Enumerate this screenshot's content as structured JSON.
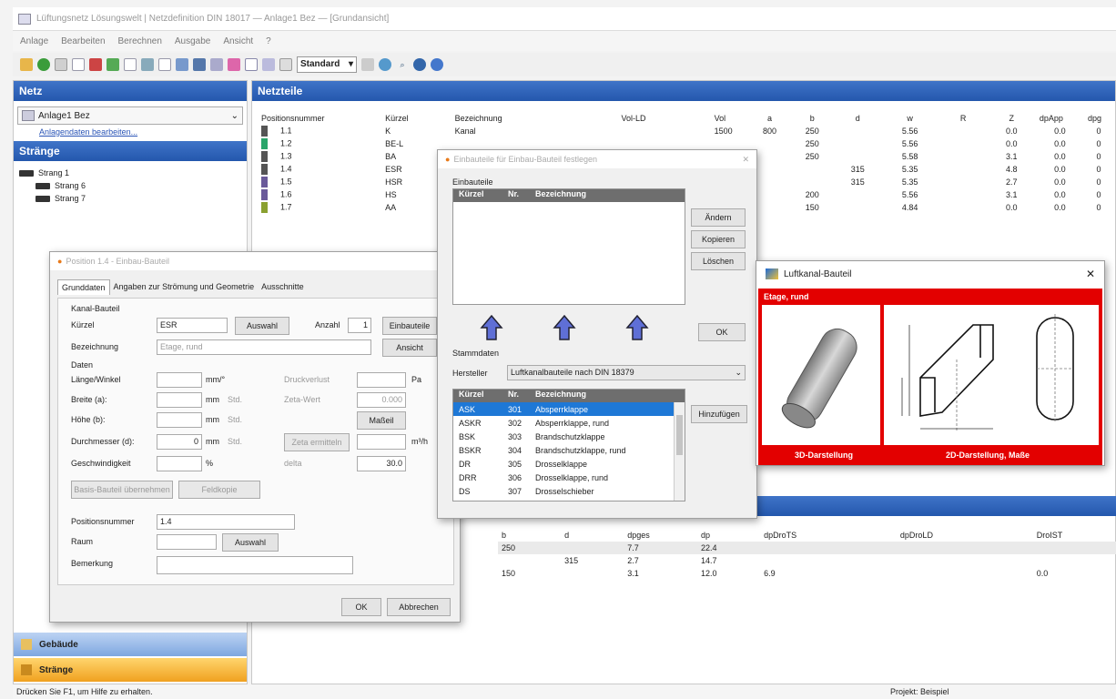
{
  "window": {
    "title": "Lüftungsnetz Lösungswelt | Netzdefinition DIN 18017 — Anlage1 Bez — [Grundansicht]"
  },
  "menu": [
    "Anlage",
    "Bearbeiten",
    "Berechnen",
    "Ausgabe",
    "Ansicht",
    "?"
  ],
  "toolbar": {
    "style_select": "Standard"
  },
  "left": {
    "netz_header": "Netz",
    "anlage_combo": "Anlage1 Bez",
    "anlage_link": "Anlagendaten bearbeiten...",
    "straenge_header": "Stränge",
    "tree": [
      {
        "label": "Strang 1"
      },
      {
        "label": "Strang 6"
      },
      {
        "label": "Strang 7"
      }
    ],
    "nav_gebaeude": "Gebäude",
    "nav_straenge": "Stränge"
  },
  "main": {
    "header": "Netzteile",
    "columns": [
      "Positionsnummer",
      "Kürzel",
      "Bezeichnung",
      "Vol-LD",
      "Vol",
      "a",
      "b",
      "d",
      "w",
      "R",
      "Z",
      "dpApp",
      "dpg"
    ],
    "rows": [
      [
        "1.1",
        "K",
        "Kanal",
        "",
        "1500",
        "800",
        "250",
        "",
        "5.56",
        "",
        "0.0",
        "0.0",
        "0"
      ],
      [
        "1.2",
        "BE-L",
        "",
        "",
        "",
        "",
        "250",
        "",
        "5.56",
        "",
        "0.0",
        "0.0",
        "0"
      ],
      [
        "1.3",
        "BA",
        "",
        "",
        "",
        "",
        "250",
        "",
        "5.58",
        "",
        "3.1",
        "0.0",
        "0"
      ],
      [
        "1.4",
        "ESR",
        "",
        "",
        "",
        "",
        "",
        "315",
        "5.35",
        "",
        "4.8",
        "0.0",
        "0"
      ],
      [
        "1.5",
        "HSR",
        "",
        "",
        "",
        "",
        "",
        "315",
        "5.35",
        "",
        "2.7",
        "0.0",
        "0"
      ],
      [
        "1.6",
        "HS",
        "",
        "",
        "",
        "",
        "200",
        "",
        "5.56",
        "",
        "3.1",
        "0.0",
        "0"
      ],
      [
        "1.7",
        "AA",
        "",
        "",
        "",
        "",
        "150",
        "",
        "4.84",
        "",
        "0.0",
        "0.0",
        "0"
      ]
    ],
    "lower_columns": [
      "b",
      "d",
      "dpges",
      "dp",
      "dpDroTS",
      "dpDroLD",
      "DroIST"
    ],
    "lower_rows": [
      [
        "250",
        "",
        "7.7",
        "22.4",
        "",
        "",
        ""
      ],
      [
        "",
        "315",
        "2.7",
        "14.7",
        "",
        "",
        ""
      ],
      [
        "150",
        "",
        "3.1",
        "12.0",
        "6.9",
        "",
        "0.0"
      ]
    ]
  },
  "dialog_bauteil": {
    "title": "Position 1.4 - Einbau-Bauteil",
    "tabs": [
      "Grunddaten",
      "Angaben zur Strömung und Geometrie",
      "Ausschnitte"
    ],
    "kanal_bauteil": "Kanal-Bauteil",
    "kuerzel_label": "Kürzel",
    "kuerzel_value": "ESR",
    "auswahl_label": "Auswahl",
    "anzahl_label": "Anzahl",
    "anzahl_value": "1",
    "einbauteile_label": "Einbauteile",
    "bezeichnung_label": "Bezeichnung",
    "bezeichnung_value": "Etage, rund",
    "ansicht_label": "Ansicht",
    "daten_label": "Daten",
    "laenge_label": "Länge/Winkel",
    "laenge_unit": "mm/°",
    "druckverlust_label": "Druckverlust",
    "pa_unit": "Pa",
    "breite_label": "Breite (a):",
    "breite_unit": "mm",
    "breite_hint": "Std.",
    "zeta_label": "Zeta-Wert",
    "zeta_value": "0.000",
    "hoehe_label": "Höhe (b):",
    "hoehe_unit": "mm",
    "hoehe_hint": "Std.",
    "massell_label": "Maßeil",
    "durchmesser_label": "Durchmesser (d):",
    "durchmesser_value": "0",
    "durchmesser_unit": "mm",
    "durchmesser_hint": "Std.",
    "zeta_ermitteln": "Zeta ermitteln",
    "ms_unit": "m³/h",
    "geschw_label": "Geschwindigkeit",
    "percent_unit": "%",
    "delta_label": "delta",
    "delta_value": "30.0",
    "basis_btn": "Basis-Bauteil übernehmen",
    "feld_btn": "Feldkopie",
    "posnr_label": "Positionsnummer",
    "posnr_value": "1.4",
    "raum_label": "Raum",
    "raum_auswahl": "Auswahl",
    "bemerkung_label": "Bemerkung",
    "ok": "OK",
    "abbrechen": "Abbrechen"
  },
  "dialog_einbau": {
    "title": "Einbauteile für Einbau-Bauteil festlegen",
    "einbauteile_label": "Einbauteile",
    "cols": [
      "Kürzel",
      "Nr.",
      "Bezeichnung"
    ],
    "btn_aendern": "Ändern",
    "btn_kopieren": "Kopieren",
    "btn_loeschen": "Löschen",
    "ok": "OK",
    "stammdaten_label": "Stammdaten",
    "hersteller_label": "Hersteller",
    "hersteller_value": "Luftkanalbauteile nach DIN 18379",
    "hinzufuegen": "Hinzufügen",
    "list": [
      {
        "k": "ASK",
        "nr": "301",
        "b": "Absperrklappe"
      },
      {
        "k": "ASKR",
        "nr": "302",
        "b": "Absperrklappe, rund"
      },
      {
        "k": "BSK",
        "nr": "303",
        "b": "Brandschutzklappe"
      },
      {
        "k": "BSKR",
        "nr": "304",
        "b": "Brandschutzklappe, rund"
      },
      {
        "k": "DR",
        "nr": "305",
        "b": "Drosselklappe"
      },
      {
        "k": "DRR",
        "nr": "306",
        "b": "Drosselklappe, rund"
      },
      {
        "k": "DS",
        "nr": "307",
        "b": "Drosselschieber"
      }
    ]
  },
  "dialog_preview": {
    "title": "Luftkanal-Bauteil",
    "subtitle": "Etage, rund",
    "cap_3d": "3D-Darstellung",
    "cap_2d": "2D-Darstellung, Maße"
  },
  "status": {
    "left": "Drücken Sie F1, um Hilfe zu erhalten.",
    "right": "Projekt: Beispiel"
  }
}
